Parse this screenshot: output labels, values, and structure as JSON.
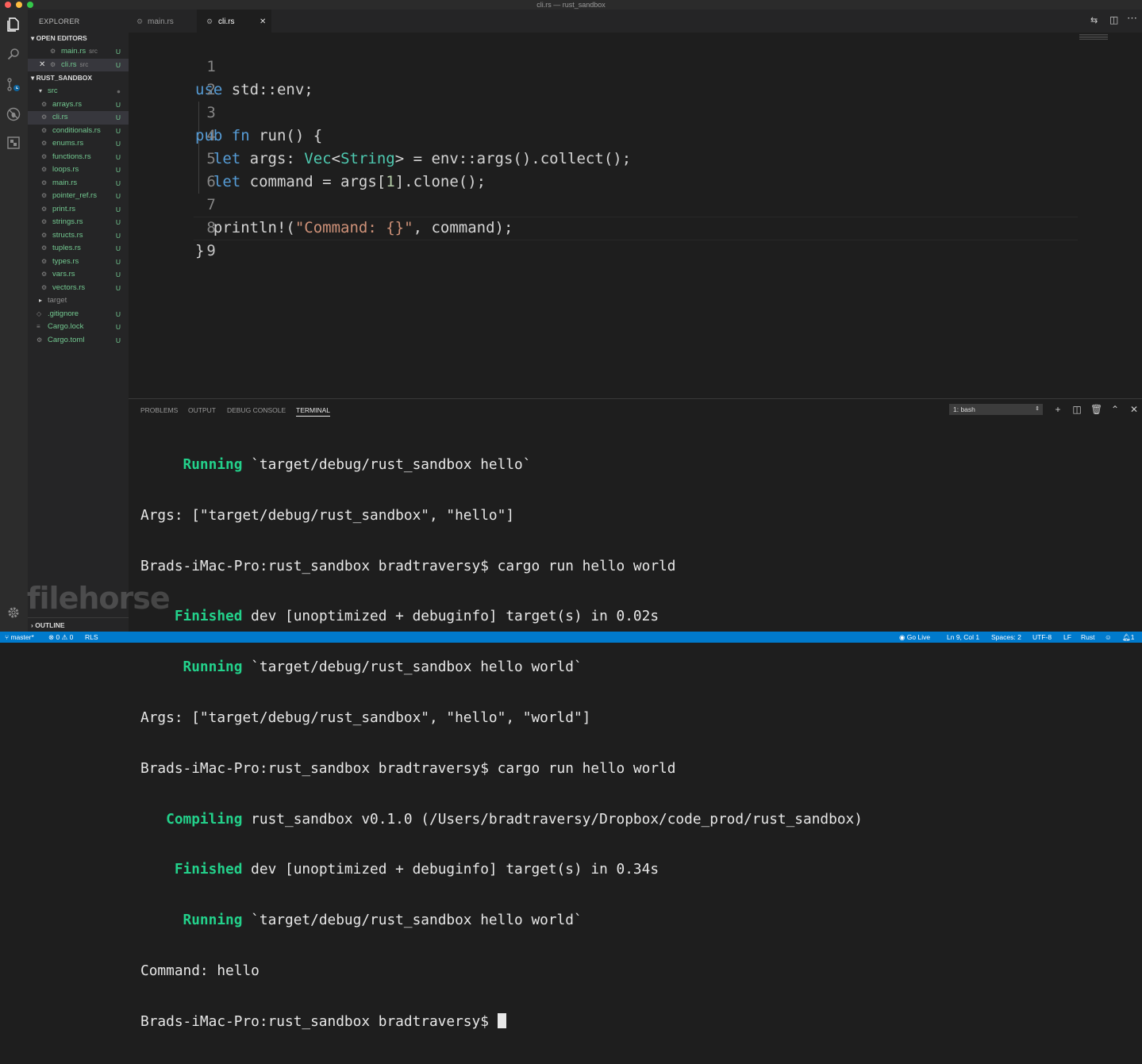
{
  "window": {
    "title": "cli.rs — rust_sandbox"
  },
  "sidebar": {
    "title": "EXPLORER",
    "open_editors_label": "OPEN EDITORS",
    "open_editors": [
      {
        "name": "main.rs",
        "dir": "src",
        "status": "U"
      },
      {
        "name": "cli.rs",
        "dir": "src",
        "status": "U"
      }
    ],
    "project_label": "RUST_SANDBOX",
    "tree": [
      {
        "name": "src",
        "status": ""
      },
      {
        "name": "arrays.rs",
        "status": "U"
      },
      {
        "name": "cli.rs",
        "status": "U"
      },
      {
        "name": "conditionals.rs",
        "status": "U"
      },
      {
        "name": "enums.rs",
        "status": "U"
      },
      {
        "name": "functions.rs",
        "status": "U"
      },
      {
        "name": "loops.rs",
        "status": "U"
      },
      {
        "name": "main.rs",
        "status": "U"
      },
      {
        "name": "pointer_ref.rs",
        "status": "U"
      },
      {
        "name": "print.rs",
        "status": "U"
      },
      {
        "name": "strings.rs",
        "status": "U"
      },
      {
        "name": "structs.rs",
        "status": "U"
      },
      {
        "name": "tuples.rs",
        "status": "U"
      },
      {
        "name": "types.rs",
        "status": "U"
      },
      {
        "name": "vars.rs",
        "status": "U"
      },
      {
        "name": "vectors.rs",
        "status": "U"
      },
      {
        "name": "target",
        "status": ""
      },
      {
        "name": ".gitignore",
        "status": "U"
      },
      {
        "name": "Cargo.lock",
        "status": "U"
      },
      {
        "name": "Cargo.toml",
        "status": "U"
      }
    ],
    "outline_label": "OUTLINE"
  },
  "tabs": [
    {
      "label": "main.rs"
    },
    {
      "label": "cli.rs"
    }
  ],
  "editor": {
    "line_numbers": [
      "1",
      "2",
      "3",
      "4",
      "5",
      "6",
      "7",
      "8",
      "9"
    ],
    "code": {
      "l1_use": "use",
      "l1_rest": " std::env;",
      "l3_pub": "pub",
      "l3_fn": "fn",
      "l3_rest": " run() {",
      "l4_let": "let",
      "l4_a": " args: ",
      "l4_vec": "Vec",
      "l4_lt": "<",
      "l4_string": "String",
      "l4_b": "> = env::args().collect();",
      "l5_let": "let",
      "l5_a": " command = args[",
      "l5_num": "1",
      "l5_b": "].clone();",
      "l7_a": "println!(",
      "l7_str": "\"Command: {}\"",
      "l7_b": ", command);",
      "l8": "}"
    }
  },
  "panel": {
    "tabs": [
      "PROBLEMS",
      "OUTPUT",
      "DEBUG CONSOLE",
      "TERMINAL"
    ],
    "terminal_select": "1: bash",
    "terminal_lines": [
      {
        "kw": "     Running",
        "text": " `target/debug/rust_sandbox hello`"
      },
      {
        "kw": "",
        "text": "Args: [\"target/debug/rust_sandbox\", \"hello\"]"
      },
      {
        "kw": "",
        "text": "Brads-iMac-Pro:rust_sandbox bradtraversy$ cargo run hello world"
      },
      {
        "kw": "    Finished",
        "text": " dev [unoptimized + debuginfo] target(s) in 0.02s"
      },
      {
        "kw": "     Running",
        "text": " `target/debug/rust_sandbox hello world`"
      },
      {
        "kw": "",
        "text": "Args: [\"target/debug/rust_sandbox\", \"hello\", \"world\"]"
      },
      {
        "kw": "",
        "text": "Brads-iMac-Pro:rust_sandbox bradtraversy$ cargo run hello world"
      },
      {
        "kw": "   Compiling",
        "text": " rust_sandbox v0.1.0 (/Users/bradtraversy/Dropbox/code_prod/rust_sandbox)"
      },
      {
        "kw": "    Finished",
        "text": " dev [unoptimized + debuginfo] target(s) in 0.34s"
      },
      {
        "kw": "     Running",
        "text": " `target/debug/rust_sandbox hello world`"
      },
      {
        "kw": "",
        "text": "Command: hello"
      },
      {
        "kw": "",
        "text": "Brads-iMac-Pro:rust_sandbox bradtraversy$ "
      }
    ]
  },
  "statusbar": {
    "branch": "master*",
    "errors": "0",
    "warnings": "0",
    "rls": "RLS",
    "go_live": "Go Live",
    "position": "Ln 9, Col 1",
    "spaces": "Spaces: 2",
    "encoding": "UTF-8",
    "eol": "LF",
    "language": "Rust",
    "notifications": "1"
  },
  "watermark": "filehorse"
}
